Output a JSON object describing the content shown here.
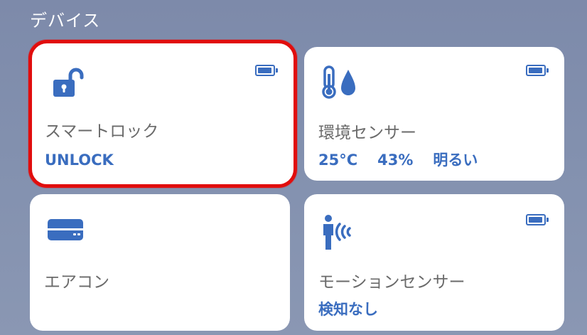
{
  "section": {
    "title": "デバイス"
  },
  "colors": {
    "accent": "#3a6dbf",
    "selection_border": "#e10d0d",
    "card_background": "#ffffff",
    "label_text": "#6a6a6a"
  },
  "devices": [
    {
      "name": "スマートロック",
      "status": "UNLOCK",
      "icon": "unlocked-padlock-icon",
      "battery_icon": "battery-icon",
      "selected": true
    },
    {
      "name": "環境センサー",
      "readings": [
        "25°C",
        "43%",
        "明るい"
      ],
      "icon": "thermometer-humidity-icon",
      "battery_icon": "battery-icon",
      "selected": false
    },
    {
      "name": "エアコン",
      "icon": "air-conditioner-icon",
      "selected": false
    },
    {
      "name": "モーションセンサー",
      "status": "検知なし",
      "icon": "motion-sensor-icon",
      "battery_icon": "battery-icon",
      "selected": false
    }
  ]
}
